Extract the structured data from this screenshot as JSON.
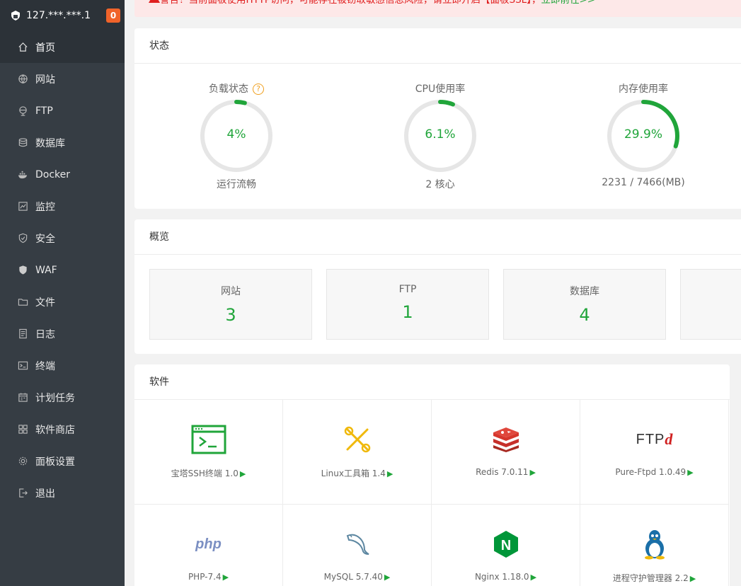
{
  "sidebar": {
    "ip": "127.***.***.1",
    "badge": "0",
    "items": [
      {
        "label": "首页",
        "icon": "home-icon"
      },
      {
        "label": "网站",
        "icon": "globe-icon"
      },
      {
        "label": "FTP",
        "icon": "ftp-icon"
      },
      {
        "label": "数据库",
        "icon": "database-icon"
      },
      {
        "label": "Docker",
        "icon": "docker-icon"
      },
      {
        "label": "监控",
        "icon": "monitor-icon"
      },
      {
        "label": "安全",
        "icon": "shield-icon"
      },
      {
        "label": "WAF",
        "icon": "waf-shield-icon"
      },
      {
        "label": "文件",
        "icon": "folder-icon"
      },
      {
        "label": "日志",
        "icon": "log-icon"
      },
      {
        "label": "终端",
        "icon": "terminal-icon"
      },
      {
        "label": "计划任务",
        "icon": "calendar-icon"
      },
      {
        "label": "软件商店",
        "icon": "apps-icon"
      },
      {
        "label": "面板设置",
        "icon": "gear-icon"
      },
      {
        "label": "退出",
        "icon": "logout-icon"
      }
    ]
  },
  "alert": {
    "text": "警告！当前面板使用HTTP访问，可能存在被窃取敏感信息风险，请立即开启【面板SSL】，",
    "link": "立即前往>>"
  },
  "status": {
    "title": "状态",
    "gauges": [
      {
        "title": "负载状态",
        "value": "4%",
        "percent": 4,
        "sub": "运行流畅",
        "help": "?"
      },
      {
        "title": "CPU使用率",
        "value": "6.1%",
        "percent": 6.1,
        "sub": "2 核心"
      },
      {
        "title": "内存使用率",
        "value": "29.9%",
        "percent": 29.9,
        "sub": "2231 / 7466(MB)"
      }
    ]
  },
  "overview": {
    "title": "概览",
    "items": [
      {
        "label": "网站",
        "value": "3"
      },
      {
        "label": "FTP",
        "value": "1"
      },
      {
        "label": "数据库",
        "value": "4"
      }
    ]
  },
  "software": {
    "title": "软件",
    "items": [
      {
        "name": "宝塔SSH终端 1.0",
        "icon": "ssh-terminal-icon"
      },
      {
        "name": "Linux工具箱 1.4",
        "icon": "toolbox-icon"
      },
      {
        "name": "Redis 7.0.11",
        "icon": "redis-icon"
      },
      {
        "name": "Pure-Ftpd 1.0.49",
        "icon": "ftpd-icon",
        "logo_text": "FTP",
        "logo_d": "d"
      },
      {
        "name": "PHP-7.4",
        "icon": "php-icon",
        "logo_text": "php"
      },
      {
        "name": "MySQL 5.7.40",
        "icon": "mysql-icon"
      },
      {
        "name": "Nginx 1.18.0",
        "icon": "nginx-icon",
        "logo_text": "N"
      },
      {
        "name": "进程守护管理器 2.2",
        "icon": "tux-icon"
      }
    ],
    "play": "▶"
  },
  "colors": {
    "accent": "#20a53a",
    "sidebar": "#363d44",
    "badge": "#f0632a",
    "alert_text": "#e02020"
  }
}
